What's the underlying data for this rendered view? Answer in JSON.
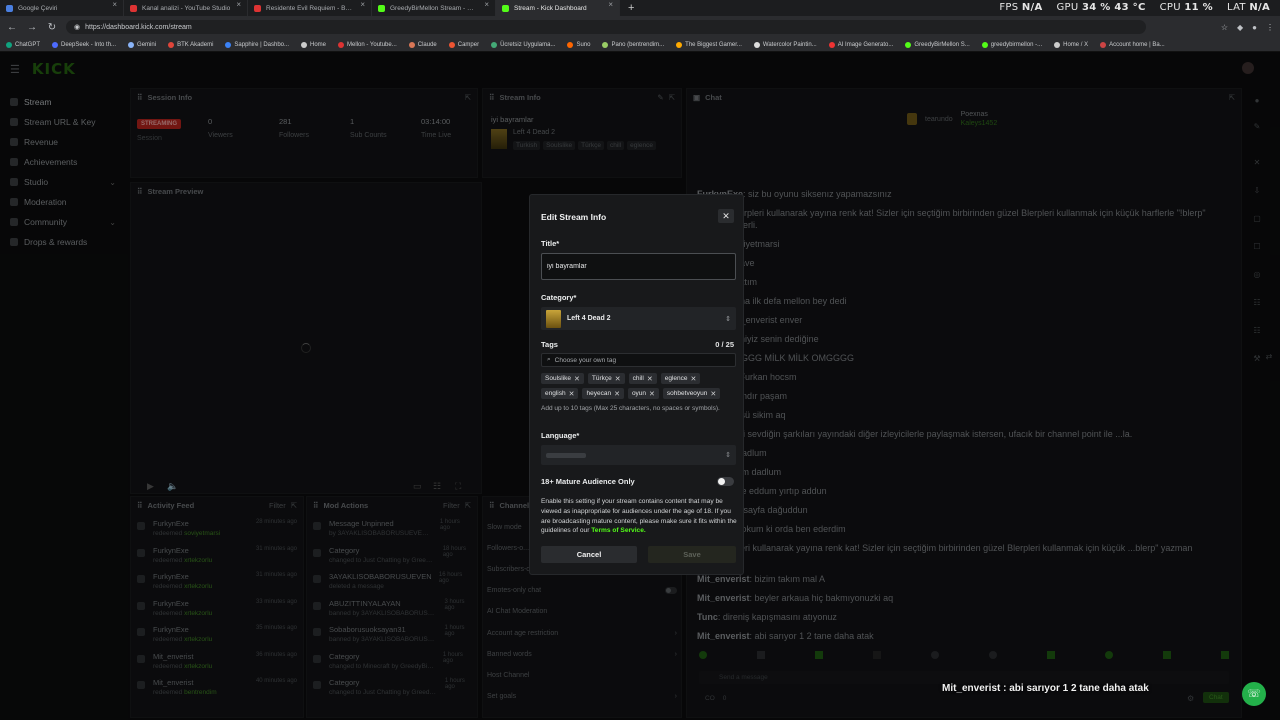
{
  "browser": {
    "tabs": [
      {
        "label": "Google Çeviri",
        "color": "#4a7fe0"
      },
      {
        "label": "Kanal analizi - YouTube Studio",
        "color": "#d33"
      },
      {
        "label": "Residente Evil Requiem - Bölüm 4",
        "color": "#d33"
      },
      {
        "label": "GreedyBirMellon Stream - Watch",
        "color": "#53fc18"
      },
      {
        "label": "Stream - Kick Dashboard",
        "color": "#53fc18",
        "active": true
      }
    ],
    "perf": {
      "fps_label": "FPS",
      "fps": "N/A",
      "gpu_label": "GPU",
      "gpu": "34 % 43 °C",
      "cpu_label": "CPU",
      "cpu": "11 %",
      "lat_label": "LAT",
      "lat": "N/A"
    },
    "url": "https://dashboard.kick.com/stream",
    "bookmarks": [
      "ChatGPT",
      "DeepSeek - Into th...",
      "Gemini",
      "BTK Akademi",
      "Sapphire | Dashbo...",
      "Home",
      "Mellon - Youtube...",
      "Claude",
      "Camper",
      "Ücretsiz Uygulama...",
      "Suno",
      "Pano (bentrendim...",
      "The Biggest Gamer...",
      "Watercolor Paintin...",
      "AI Image Generato...",
      "GreedyBirMellon S...",
      "greedybirmellon -...",
      "Home / X",
      "Account home | Ba..."
    ]
  },
  "sidebar": {
    "items": [
      {
        "label": "Stream",
        "active": true
      },
      {
        "label": "Stream URL & Key"
      },
      {
        "label": "Revenue"
      },
      {
        "label": "Achievements"
      },
      {
        "label": "Studio",
        "chevron": true
      },
      {
        "label": "Moderation"
      },
      {
        "label": "Community",
        "chevron": true
      },
      {
        "label": "Drops & rewards"
      }
    ]
  },
  "session": {
    "title": "Session Info",
    "status": "STREAMING",
    "stats": [
      {
        "value": "Session",
        "label": ""
      },
      {
        "value": "0",
        "label": "Viewers"
      },
      {
        "value": "281",
        "label": "Followers"
      },
      {
        "value": "1",
        "label": "Sub Counts"
      },
      {
        "value": "03:14:00",
        "label": "Time Live"
      }
    ]
  },
  "stream_info": {
    "title": "Stream Info",
    "stream_title": "iyi bayramlar",
    "category": "Left 4 Dead 2",
    "tags": [
      "Turkish",
      "Soulslike",
      "Türkçe",
      "chill",
      "eglence"
    ]
  },
  "preview": {
    "title": "Stream Preview"
  },
  "activity": {
    "title": "Activity Feed",
    "filter": "Filter",
    "items": [
      {
        "name": "FurkynExe",
        "sub": "redeemed",
        "target": "soviyetmarsi",
        "time": "28 minutes ago"
      },
      {
        "name": "FurkynExe",
        "sub": "redeemed",
        "target": "xrtekzorlu",
        "time": "31 minutes ago"
      },
      {
        "name": "FurkynExe",
        "sub": "redeemed",
        "target": "xrtekzorlu",
        "time": "31 minutes ago"
      },
      {
        "name": "FurkynExe",
        "sub": "redeemed",
        "target": "xrtekzorlu",
        "time": "33 minutes ago"
      },
      {
        "name": "FurkynExe",
        "sub": "redeemed",
        "target": "xrtekzorlu",
        "time": "35 minutes ago"
      },
      {
        "name": "Mit_enverist",
        "sub": "redeemed",
        "target": "xrtekzorlu",
        "time": "36 minutes ago"
      },
      {
        "name": "Mit_enverist",
        "sub": "redeemed",
        "target": "bentrendim",
        "time": "40 minutes ago"
      }
    ]
  },
  "modactions": {
    "title": "Mod Actions",
    "filter": "Filter",
    "items": [
      {
        "name": "Message Unpinned",
        "sub": "by 3AYAKLISOBABORUSUEVEN33",
        "time": "1 hours ago"
      },
      {
        "name": "Category",
        "sub": "changed to Just Chatting by GreedyBirMellon",
        "time": "18 hours ago"
      },
      {
        "name": "3AYAKLISOBABORUSUEVEN33",
        "sub": "deleted a message",
        "time": "16 hours ago"
      },
      {
        "name": "ABUZITTINYALAYAN",
        "sub": "banned by 3AYAKLISOBABORUSUEVEN33",
        "time": "3 hours ago"
      },
      {
        "name": "Sobaborusuoksayan31",
        "sub": "banned by 3AYAKLISOBABORUSUEVEN33",
        "time": "1 hours ago"
      },
      {
        "name": "Category",
        "sub": "changed to Minecraft by GreedyBirMellon",
        "time": "1 hours ago"
      },
      {
        "name": "Category",
        "sub": "changed to Just Chatting by GreedyBirMellon",
        "time": "1 hours ago"
      }
    ]
  },
  "channel": {
    "title": "Channel",
    "items": [
      {
        "label": "Slow mode"
      },
      {
        "label": "Followers-o..."
      },
      {
        "label": "Subscribers-o..."
      },
      {
        "label": "Emotes-only chat"
      },
      {
        "label": "AI Chat Moderation"
      },
      {
        "label": "Account age restriction"
      },
      {
        "label": "Banned words"
      },
      {
        "label": "Host Channel"
      },
      {
        "label": "Set goals"
      }
    ]
  },
  "chat": {
    "title": "Chat",
    "pinned_user": "Poexnas",
    "pinned_user2": "Kaleys1452",
    "top_user": "tearundo",
    "lines": [
      {
        "user": "FurkynExe",
        "text": "siz bu oyunu siksenız yapamazsınız",
        "bot": false
      },
      {
        "user": "BotRix",
        "text": "Blerpleri kullanarak yayına renk kat! Sizler için seçtiğim birbirinden güzel Blerpleri kullanmak için küçük harflerle \"!blerp\" yazman yeterli.",
        "bot": true
      },
      {
        "user": "",
        "text": "...emed soviyetmarsi",
        "bot": false
      },
      {
        "user": "...t",
        "text": "attım dave",
        "bot": false
      },
      {
        "user": "...t",
        "text": "davet attım",
        "bot": false
      },
      {
        "user": "...xe",
        "text": "Poexna ilk defa mellon bey dedi",
        "bot": false
      },
      {
        "user": "...xe",
        "text": "@Mit_enverist enver",
        "bot": false
      },
      {
        "user": "...xe",
        "text": "girermiyiz senin dediğine",
        "bot": false
      },
      {
        "user": "...t",
        "text": "OMGGGGG MİLK MİLK OMGGGG",
        "bot": false
      },
      {
        "user": "...t",
        "text": "gireriz Furkan hocsm",
        "bot": false
      },
      {
        "user": "...xe",
        "text": "tamamdır paşam",
        "bot": false
      },
      {
        "user": "...t",
        "text": "görünüşü sikim aq",
        "bot": false
      },
      {
        "user": "...ix",
        "text": "Eğer ki sevdiğin şarkıları yayındaki diğer izleyicilerle paylaşmak istersen, ufacık bir channel point ile ...la.",
        "bot": true
      },
      {
        "user": "...xe",
        "text": "aaa dadlum",
        "bot": false
      },
      {
        "user": "...xe",
        "text": "dadlum dadlum",
        "bot": false
      },
      {
        "user": "...xe",
        "text": "bak ne eddum yırtıp addun",
        "bot": false
      },
      {
        "user": "...xe",
        "text": "sayfa sayfa dağuddun",
        "bot": false
      },
      {
        "user": "...xe",
        "text": "ben yokum ki orda ben ederdim",
        "bot": false
      },
      {
        "user": "...ix",
        "text": "Blerpleri kullanarak yayına renk kat! Sizler için seçtiğim birbirinden güzel Blerpleri kullanmak için küçük ...blerp\" yazman yeterli.",
        "bot": true
      },
      {
        "user": "Mit_enverist",
        "text": "bizim takım mal A",
        "bot": false
      },
      {
        "user": "Mit_enverist",
        "text": "beyler arkaua hiç bakmıyonuzki aq",
        "bot": false
      },
      {
        "user": "Tunc",
        "text": "direniş kapışmasını atıyonuz",
        "bot": false
      },
      {
        "user": "Mit_enverist",
        "text": "abi sarıyor 1 2 tane daha atak",
        "bot": false
      }
    ],
    "input_placeholder": "Send a message",
    "send_label": "Chat",
    "footer_counts": [
      "CO",
      "0"
    ]
  },
  "overlay_caption": {
    "user": "Mit_enverist",
    "text": "abi sarıyor 1 2 tane daha atak"
  },
  "modal": {
    "title": "Edit Stream Info",
    "title_label": "Title*",
    "title_value": "iyi bayramlar",
    "category_label": "Category*",
    "category_value": "Left 4 Dead 2",
    "tags_label": "Tags",
    "tags_count": "0 / 25",
    "tag_placeholder": "Choose your own tag",
    "tags": [
      "Soulslike",
      "Türkçe",
      "chill",
      "eglence",
      "english",
      "heyecan",
      "oyun",
      "sohbetveoyun"
    ],
    "tags_help": "Add up to 10 tags (Max 25 characters, no spaces or symbols).",
    "language_label": "Language*",
    "mature_label": "18+ Mature Audience Only",
    "mature_enabled": false,
    "mature_desc": "Enable this setting if your stream contains content that may be viewed as inappropriate for audiences under the age of 18. If you are broadcasting mature content, please make sure it fits within the guidelines of our",
    "terms_link": "Terms of Service.",
    "cancel_label": "Cancel",
    "save_label": "Save"
  },
  "colors": {
    "brand": "#53fc18",
    "live": "#b0221d",
    "bg": "#0b0c0d",
    "panel": "#111214",
    "modal": "#18191b"
  },
  "icons": [
    "menu-icon",
    "search-icon",
    "close-icon",
    "chevron-down-icon",
    "play-icon",
    "volume-icon",
    "fullscreen-icon",
    "popout-icon",
    "edit-icon",
    "emoji-icon",
    "settings-icon",
    "chat-bubble-icon"
  ]
}
